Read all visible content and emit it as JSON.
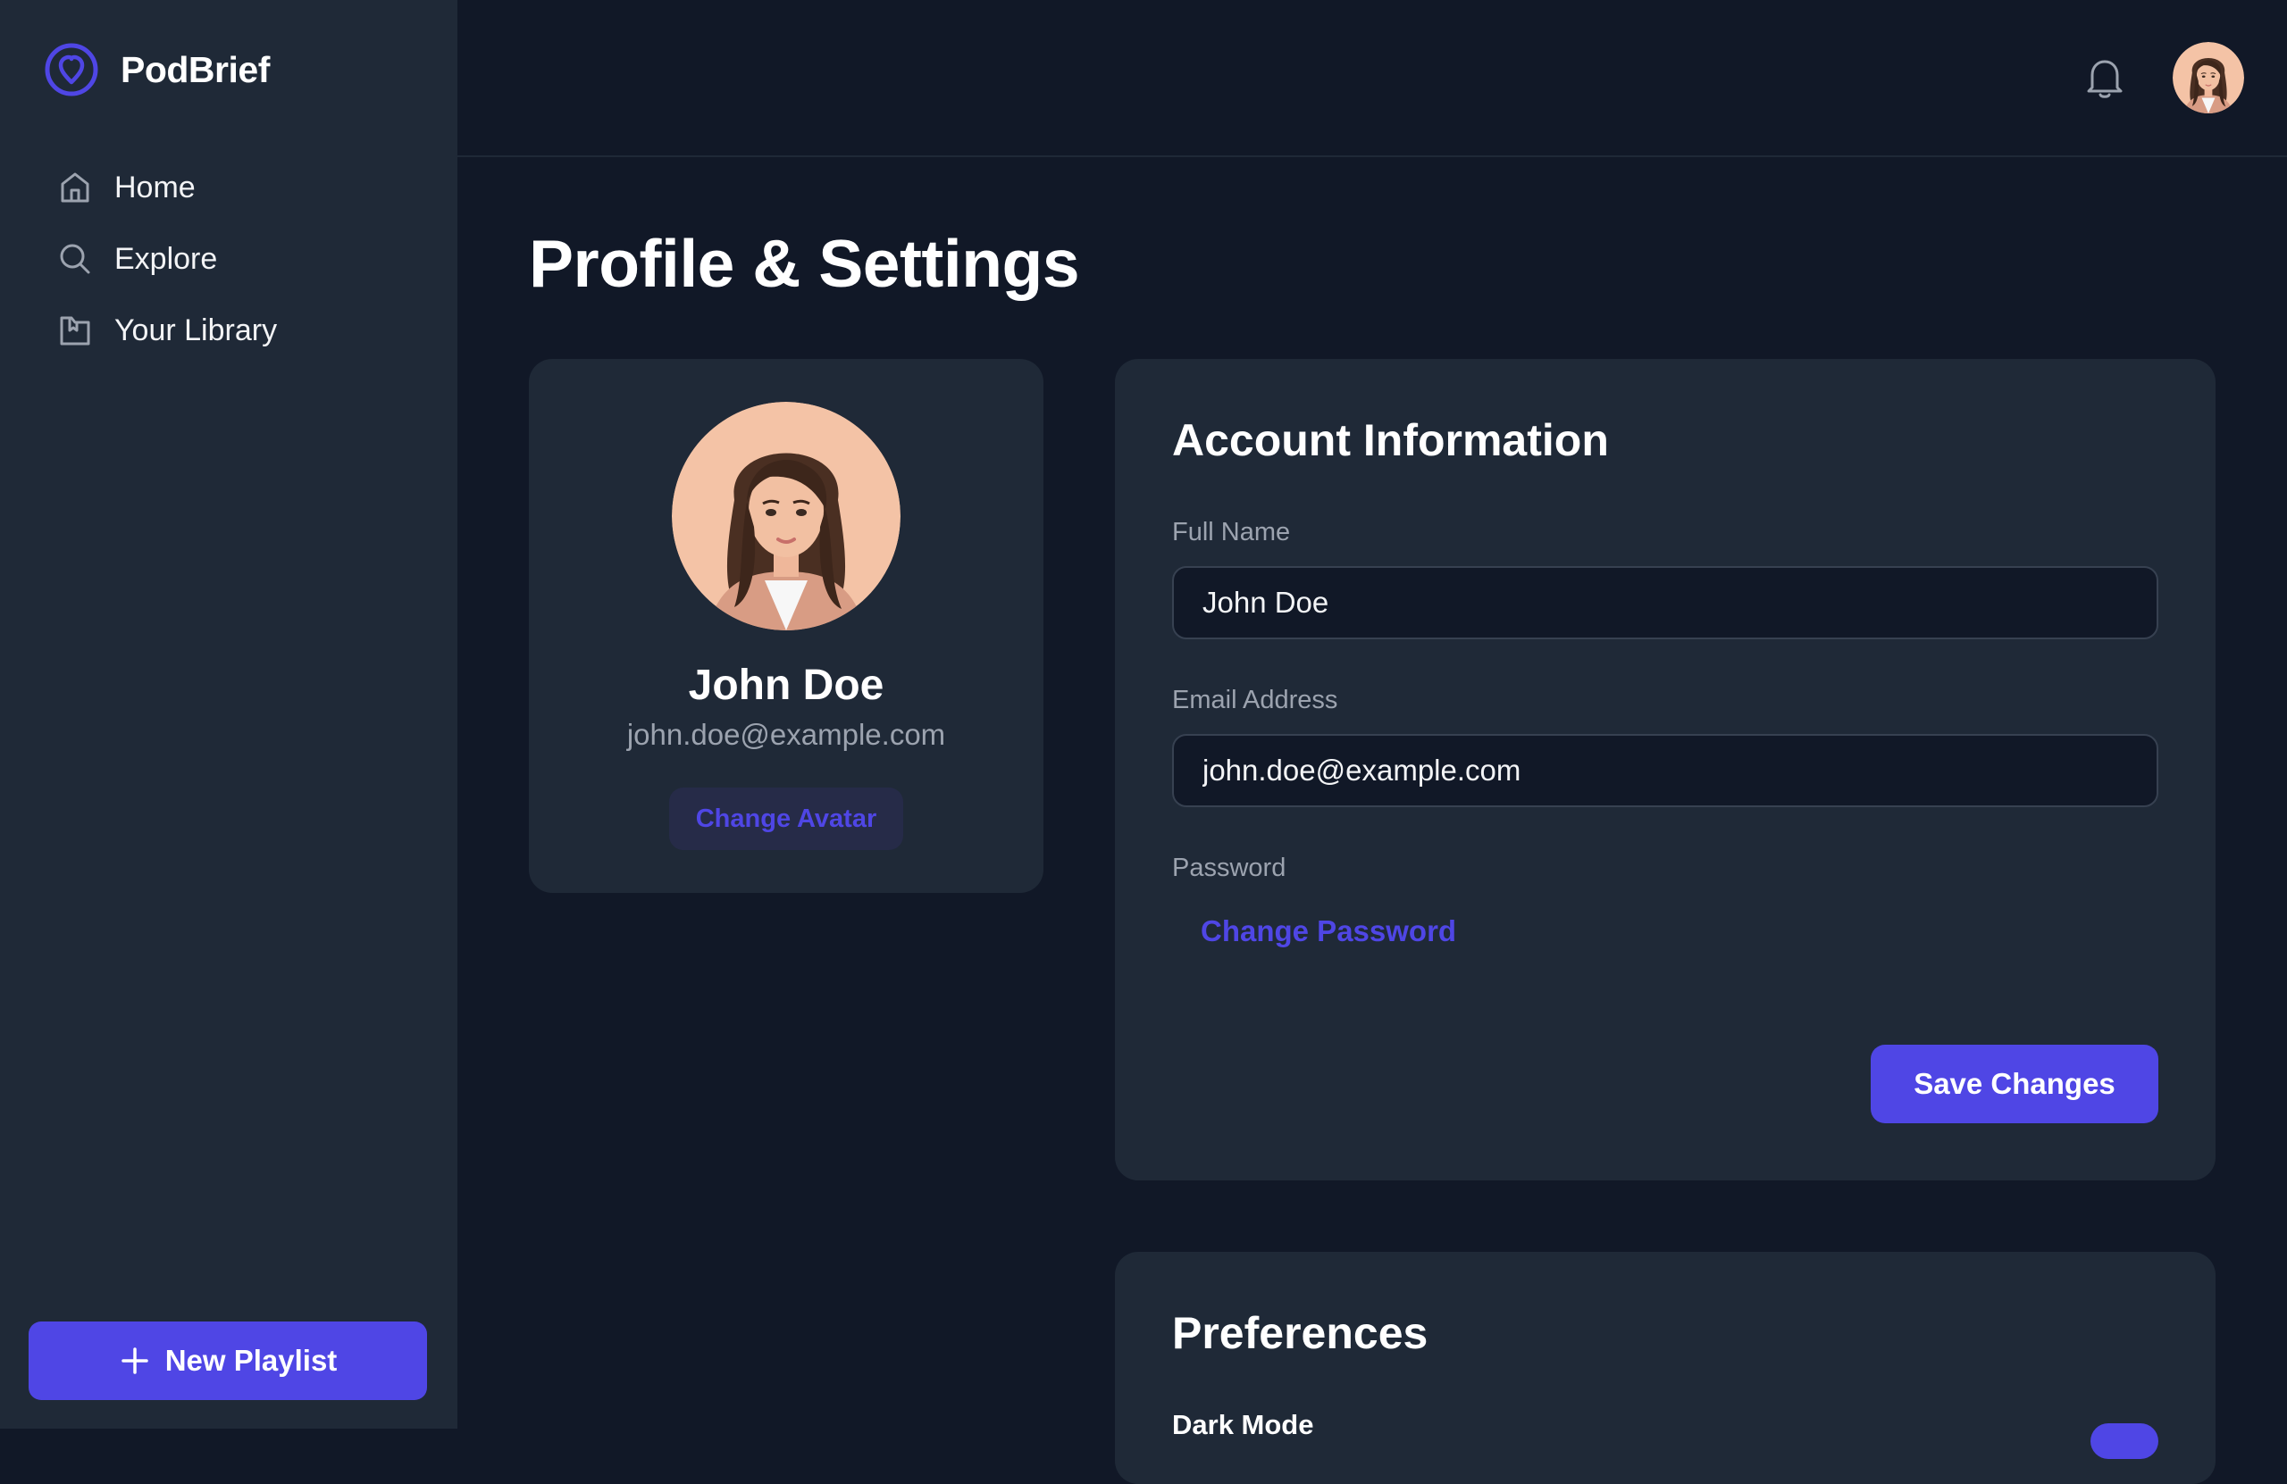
{
  "app": {
    "name": "PodBrief",
    "accent": "#4f46e5"
  },
  "sidebar": {
    "items": [
      {
        "label": "Home",
        "icon": "home-icon"
      },
      {
        "label": "Explore",
        "icon": "search-icon"
      },
      {
        "label": "Your Library",
        "icon": "library-icon"
      }
    ],
    "new_playlist_label": "New Playlist"
  },
  "header": {
    "notification_icon": "bell-icon",
    "avatar": "user-avatar"
  },
  "page": {
    "title": "Profile & Settings"
  },
  "profile": {
    "name": "John Doe",
    "email": "john.doe@example.com",
    "change_avatar_label": "Change Avatar"
  },
  "account": {
    "title": "Account Information",
    "full_name_label": "Full Name",
    "full_name_value": "John Doe",
    "email_label": "Email Address",
    "email_value": "john.doe@example.com",
    "password_label": "Password",
    "change_password_label": "Change Password",
    "save_label": "Save Changes"
  },
  "preferences": {
    "title": "Preferences",
    "dark_mode_label": "Dark Mode",
    "dark_mode_on": true
  }
}
